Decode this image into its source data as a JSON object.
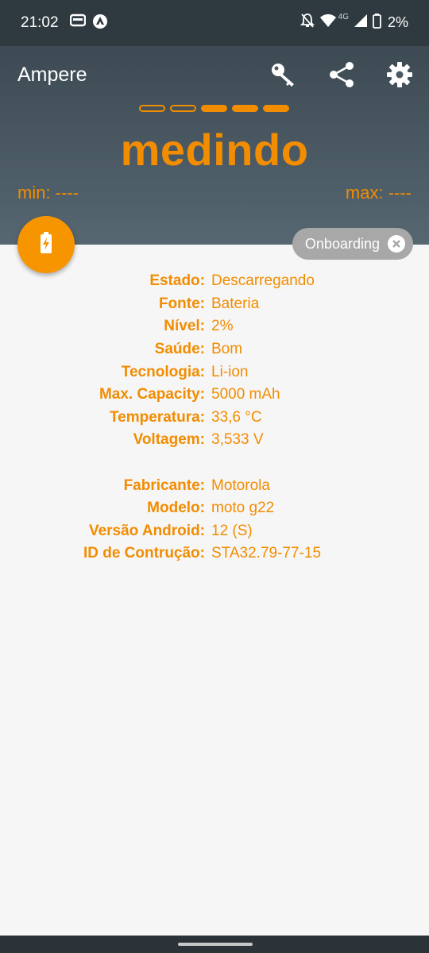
{
  "status_bar": {
    "time": "21:02",
    "network_type": "4G",
    "battery_percent": "2%"
  },
  "app": {
    "title": "Ampere",
    "toolbar": {
      "key_icon": "key-icon",
      "share_icon": "share-icon",
      "settings_icon": "gear-icon"
    },
    "progress_dots": {
      "total": 5,
      "filled": 3
    },
    "status_text": "medindo",
    "min_text": "min: ----",
    "max_text": "max: ----",
    "accent_color": "#f28c00"
  },
  "onboarding_chip": {
    "label": "Onboarding"
  },
  "info": {
    "battery": [
      {
        "label": "Estado:",
        "value": "Descarregando"
      },
      {
        "label": "Fonte:",
        "value": "Bateria"
      },
      {
        "label": "Nível:",
        "value": "2%"
      },
      {
        "label": "Saúde:",
        "value": "Bom"
      },
      {
        "label": "Tecnologia:",
        "value": "Li-ion"
      },
      {
        "label": "Max. Capacity:",
        "value": "5000 mAh"
      },
      {
        "label": "Temperatura:",
        "value": "33,6 °C"
      },
      {
        "label": "Voltagem:",
        "value": "3,533 V"
      }
    ],
    "device": [
      {
        "label": "Fabricante:",
        "value": "Motorola"
      },
      {
        "label": "Modelo:",
        "value": "moto g22"
      },
      {
        "label": "Versão Android:",
        "value": "12 (S)"
      },
      {
        "label": "ID de Contrução:",
        "value": "STA32.79-77-15"
      }
    ]
  }
}
